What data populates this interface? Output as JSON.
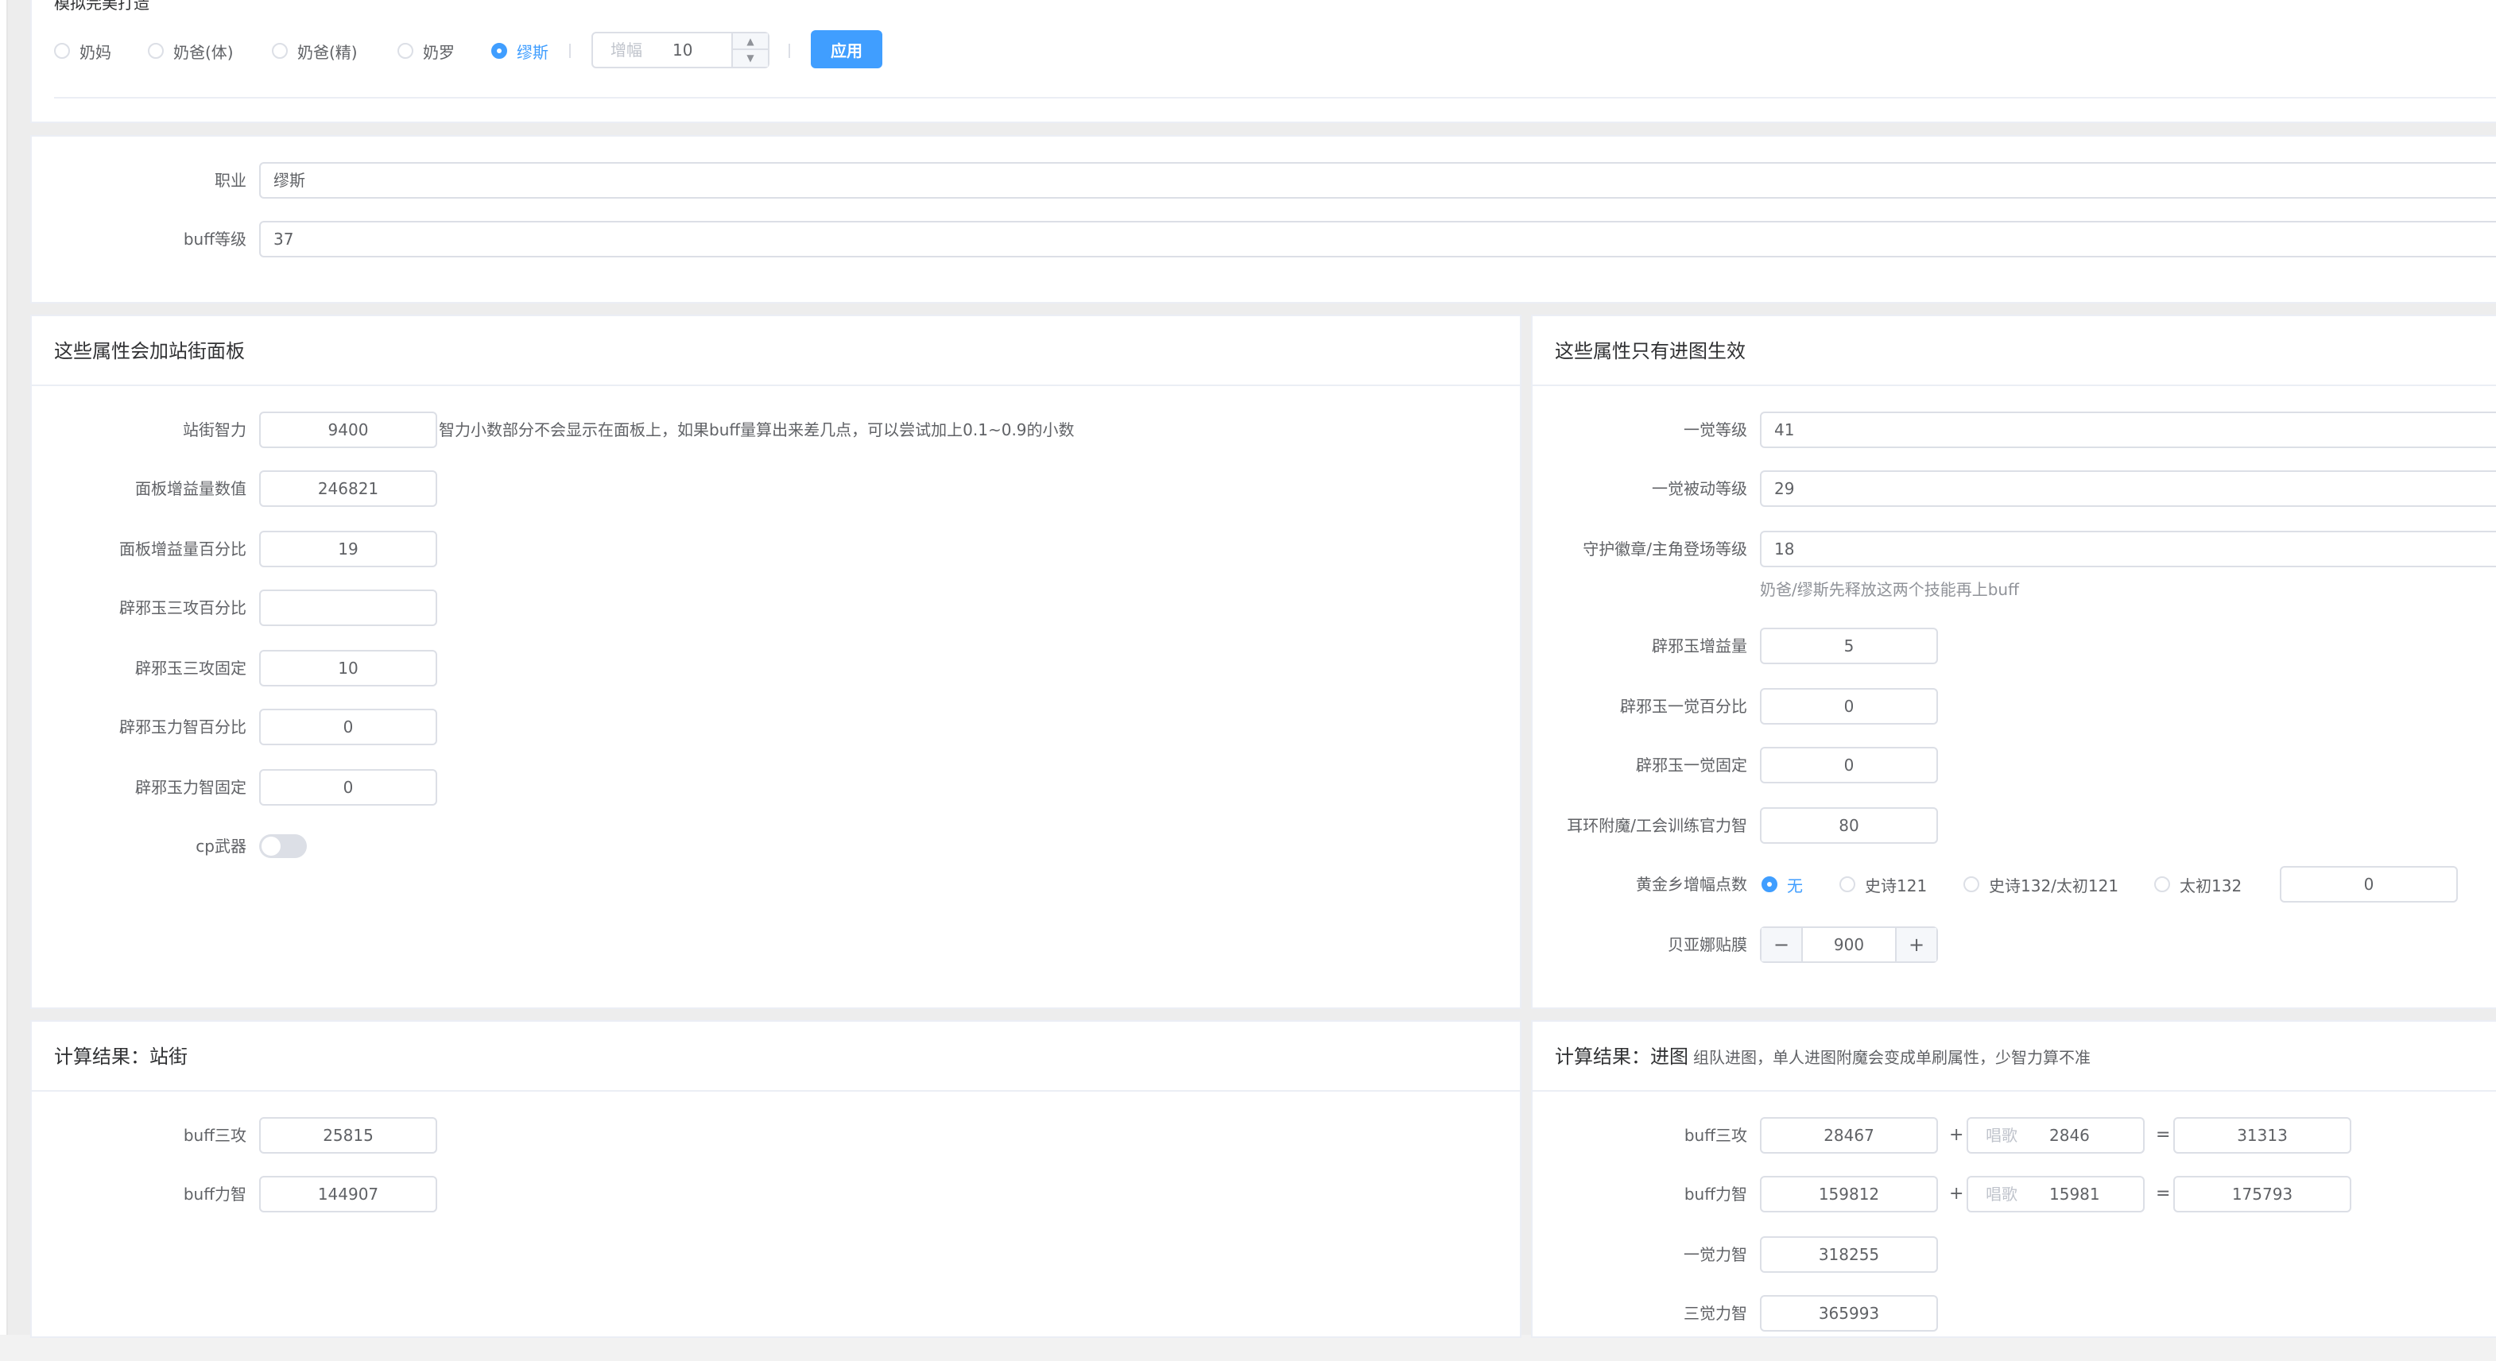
{
  "top": {
    "section_title": "模拟完美打造",
    "radios": [
      {
        "label": "奶妈",
        "checked": false
      },
      {
        "label": "奶爸(体)",
        "checked": false
      },
      {
        "label": "奶爸(精)",
        "checked": false
      },
      {
        "label": "奶罗",
        "checked": false
      },
      {
        "label": "缪斯",
        "checked": true
      }
    ],
    "boost_prefix": "增幅",
    "boost_value": "10",
    "apply_label": "应用"
  },
  "basic": {
    "job_label": "职业",
    "job_value": "缪斯",
    "buff_level_label": "buff等级",
    "buff_level_value": "37"
  },
  "street_panel": {
    "title": "这些属性会加站街面板",
    "int_label": "站街智力",
    "int_value": "9400",
    "int_note": "智力小数部分不会显示在面板上，如果buff量算出来差几点，可以尝试加上0.1~0.9的小数",
    "panel_gain_label": "面板增益量数值",
    "panel_gain_value": "246821",
    "panel_pct_label": "面板增益量百分比",
    "panel_pct_value": "19",
    "jade_atk_pct_label": "辟邪玉三攻百分比",
    "jade_atk_pct_value": "",
    "jade_atk_fixed_label": "辟邪玉三攻固定",
    "jade_atk_fixed_value": "10",
    "jade_stat_pct_label": "辟邪玉力智百分比",
    "jade_stat_pct_value": "0",
    "jade_stat_fixed_label": "辟邪玉力智固定",
    "jade_stat_fixed_value": "0",
    "cp_label": "cp武器"
  },
  "dungeon_panel": {
    "title": "这些属性只有进图生效",
    "awaken1_label": "一觉等级",
    "awaken1_value": "41",
    "awaken1_passive_label": "一觉被动等级",
    "awaken1_passive_value": "29",
    "guard_label": "守护徽章/主角登场等级",
    "guard_value": "18",
    "guard_hint": "奶爸/缪斯先释放这两个技能再上buff",
    "jade_gain_label": "辟邪玉增益量",
    "jade_gain_value": "5",
    "jade_awk_pct_label": "辟邪玉一觉百分比",
    "jade_awk_pct_value": "0",
    "jade_awk_fixed_label": "辟邪玉一觉固定",
    "jade_awk_fixed_value": "0",
    "earring_label": "耳环附魔/工会训练官力智",
    "earring_value": "80",
    "gold_label": "黄金乡增幅点数",
    "gold_options": [
      {
        "label": "无",
        "checked": true
      },
      {
        "label": "史诗121",
        "checked": false
      },
      {
        "label": "史诗132/太初121",
        "checked": false
      },
      {
        "label": "太初132",
        "checked": false
      }
    ],
    "gold_value": "0",
    "belia_label": "贝亚娜贴膜",
    "belia_value": "900",
    "minus": "−",
    "plus": "+"
  },
  "result_street": {
    "title": "计算结果：站街",
    "atk_label": "buff三攻",
    "atk_value": "25815",
    "stat_label": "buff力智",
    "stat_value": "144907"
  },
  "result_dungeon": {
    "title": "计算结果：进图",
    "subtitle": "组队进图，单人进图附魔会变成单刷属性，少智力算不准",
    "atk_label": "buff三攻",
    "atk_value": "28467",
    "atk_song_prefix": "唱歌",
    "atk_song_value": "2846",
    "atk_total": "31313",
    "stat_label": "buff力智",
    "stat_value": "159812",
    "stat_song_prefix": "唱歌",
    "stat_song_value": "15981",
    "stat_total": "175793",
    "awk1_label": "一觉力智",
    "awk1_value": "318255",
    "awk3_label": "三觉力智",
    "awk3_value": "365993",
    "plus_sign": "+",
    "equals_sign": "="
  },
  "colors": {
    "accent": "#409eff",
    "border": "#dcdfe6",
    "text": "#606266",
    "title": "#303133"
  }
}
